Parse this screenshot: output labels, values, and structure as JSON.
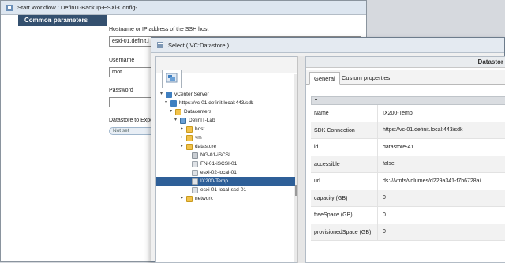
{
  "workflow": {
    "title": "Start Workflow : DefinIT-Backup-ESXi-Config-",
    "section": "Common parameters",
    "host_label": "Hostname or IP address of the SSH host",
    "host_value": "esxi-01.definit.l",
    "username_label": "Username",
    "username_value": "root",
    "password_label": "Password",
    "password_value": "",
    "datastore_label": "Datastore to Expor",
    "datastore_value": "Not set"
  },
  "dialog": {
    "title": "Select ( VC:Datastore )",
    "header": "Datastor",
    "tabs": [
      "General",
      "Custom properties"
    ],
    "props_header": "▾",
    "tree": {
      "root": "vCenter Server",
      "server": "https://vc-01.definit.local:443/sdk",
      "datacenters": "Datacenters",
      "lab": "DefinIT-Lab",
      "host": "host",
      "vm": "vm",
      "datastore": "datastore",
      "ds_items": [
        "NG-01-iSCSI",
        "FN-01-iSCSI-01",
        "esxi-02-local-01",
        "IX200-Temp",
        "esxi-01-local-ssd-01"
      ],
      "network": "network"
    },
    "properties": [
      {
        "key": "Name",
        "value": "IX200-Temp"
      },
      {
        "key": "SDK Connection",
        "value": "https://vc-01.definit.local:443/sdk"
      },
      {
        "key": "id",
        "value": "datastore-41"
      },
      {
        "key": "accessible",
        "value": "false"
      },
      {
        "key": "url",
        "value": "ds:///vmfs/volumes/d229a341-f7b6728a/"
      },
      {
        "key": "capacity (GB)",
        "value": "0"
      },
      {
        "key": "freeSpace (GB)",
        "value": "0"
      },
      {
        "key": "provisionedSpace (GB)",
        "value": "0"
      }
    ]
  }
}
